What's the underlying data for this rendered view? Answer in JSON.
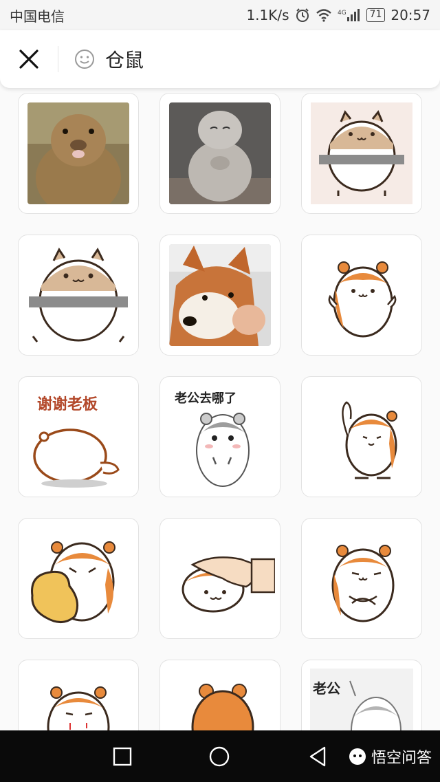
{
  "status_bar": {
    "carrier": "中国电信",
    "speed": "1.1K/s",
    "network": "4G",
    "battery": "71",
    "time": "20:57"
  },
  "search": {
    "query": "仓鼠"
  },
  "stickers": [
    {
      "name": "prairie-dog-photo",
      "caption": ""
    },
    {
      "name": "chinchilla-photo",
      "caption": ""
    },
    {
      "name": "hamster-on-bar-small",
      "caption": ""
    },
    {
      "name": "hamster-on-bar-large",
      "caption": ""
    },
    {
      "name": "shiba-dog-photo",
      "caption": ""
    },
    {
      "name": "orange-hamster-thumbs",
      "caption": ""
    },
    {
      "name": "hamster-thanks-boss",
      "caption": "谢谢老板"
    },
    {
      "name": "gray-hamster-husband",
      "caption": "老公去哪了"
    },
    {
      "name": "hamster-waving",
      "caption": ""
    },
    {
      "name": "hamster-with-peanut",
      "caption": ""
    },
    {
      "name": "hamster-being-petted",
      "caption": ""
    },
    {
      "name": "hamster-arms-crossed",
      "caption": ""
    },
    {
      "name": "hamster-drooling",
      "caption": ""
    },
    {
      "name": "orange-hamster-back",
      "caption": ""
    },
    {
      "name": "gray-hamster-husband-partial",
      "caption": "老公"
    }
  ],
  "watermark": {
    "text": "悟空问答"
  },
  "colors": {
    "orange": "#e88a3c",
    "outline": "#3b2a1e"
  }
}
